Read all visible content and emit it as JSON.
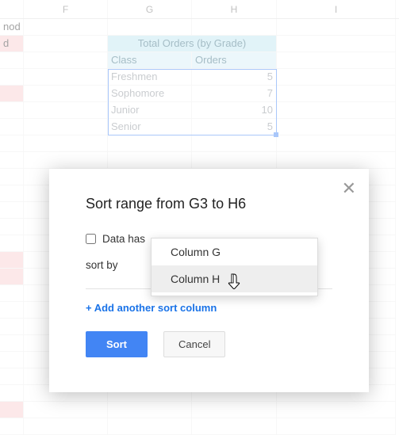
{
  "columns": {
    "E": "",
    "F": "F",
    "G": "G",
    "H": "H",
    "I": "I"
  },
  "sheet": {
    "mergeTitle": "Total Orders (by Grade)",
    "headers": {
      "g": "Class",
      "h": "Orders"
    },
    "rows": [
      {
        "class": "Freshmen",
        "orders": "5"
      },
      {
        "class": "Sophomore",
        "orders": "7"
      },
      {
        "class": "Junior",
        "orders": "10"
      },
      {
        "class": "Senior",
        "orders": "5"
      }
    ],
    "leftFrag": [
      {
        "text": "nod",
        "pink": false
      },
      {
        "text": "d",
        "pink": true
      },
      {
        "text": "",
        "pink": false
      },
      {
        "text": "",
        "pink": true
      },
      {
        "text": "",
        "pink": false
      }
    ]
  },
  "dialog": {
    "title": "Sort range from G3 to H6",
    "checkboxLabel": "Data has",
    "sortByLabel": "sort by",
    "addAnother": "+ Add another sort column",
    "sortBtn": "Sort",
    "cancelBtn": "Cancel"
  },
  "dropdown": {
    "items": [
      "Column G",
      "Column H"
    ],
    "highlightIndex": 1
  }
}
